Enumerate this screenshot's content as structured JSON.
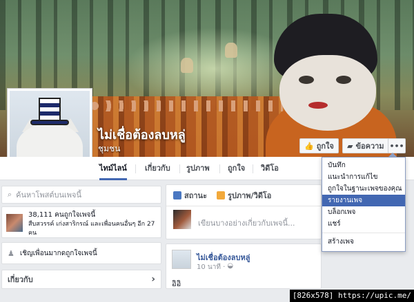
{
  "page": {
    "title": "ไม่เชื่อต้องลบหลู่",
    "category": "ชุมชน",
    "buttons": {
      "like": "ถูกใจ",
      "message": "ข้อความ",
      "more": "•••"
    }
  },
  "tabs": [
    {
      "label": "ไทม์ไลน์"
    },
    {
      "label": "เกี่ยวกับ"
    },
    {
      "label": "รูปภาพ"
    },
    {
      "label": "ถูกใจ"
    },
    {
      "label": "วิดีโอ"
    }
  ],
  "sidebar": {
    "search_placeholder": "ค้นหาโพสต์บนเพจนี้",
    "likes_count_text": "38,111 คนถูกใจเพจนี้",
    "likes_friends_text": "สืบสวรรค์ เก่งสาริกรณ์ และเพื่อนคนอื่นๆ อีก 27 คน",
    "invite_text": "เชิญเพื่อนมากดถูกใจเพจนี้",
    "about_label": "เกี่ยวกับ",
    "about_chevron": "›"
  },
  "composer": {
    "status_tab": "สถานะ",
    "photo_tab": "รูปภาพ/วิดีโอ",
    "placeholder": "เขียนบางอย่างเกี่ยวกับเพจนี้..."
  },
  "post": {
    "author": "ไม่เชื่อต้องลบหลู่",
    "time": "10 นาที ·",
    "text": "อิอิ"
  },
  "menu": {
    "items": [
      {
        "label": "บันทึก"
      },
      {
        "label": "แนะนำการแก้ไข"
      },
      {
        "label": "ถูกใจในฐานะเพจของคุณ"
      },
      {
        "label": "รายงานเพจ"
      },
      {
        "label": "บล็อกเพจ"
      },
      {
        "label": "แชร์"
      }
    ],
    "create_page": "สร้างเพจ",
    "selected_color": "#4267b2"
  },
  "watermark": "[826x578] https://upic.me/",
  "colors": {
    "accent": "#4267b2",
    "tab_border": "#dddfe2"
  },
  "icons": [
    "search-icon",
    "like-icon",
    "message-icon",
    "invite-icon",
    "chevron-right-icon",
    "status-icon",
    "photo-icon",
    "globe-icon"
  ]
}
